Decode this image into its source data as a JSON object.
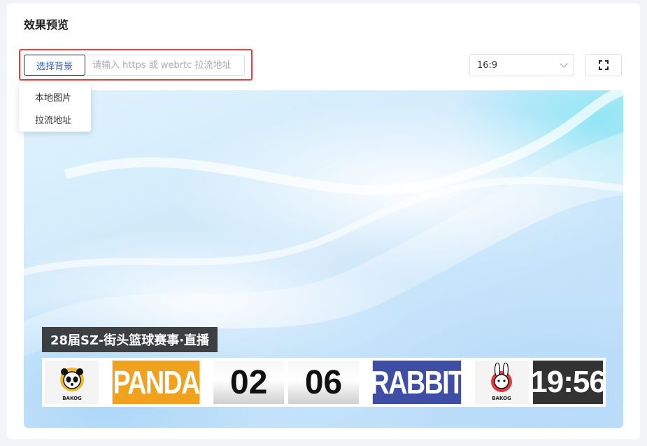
{
  "section": {
    "title": "效果预览"
  },
  "toolbar": {
    "bg_button_label": "选择背景",
    "url_placeholder": "请输入 https 或 webrtc 拉流地址",
    "ratio_value": "16:9"
  },
  "dropdown": {
    "items": [
      {
        "label": "本地图片"
      },
      {
        "label": "拉流地址"
      }
    ]
  },
  "preview": {
    "match_title": "28届SZ-街头篮球赛事·直播",
    "scoreboard": {
      "home_team": "PANDA",
      "home_score": "02",
      "away_score": "06",
      "away_team": "RABBIT",
      "clock": "19:56",
      "home_logo_text": "BAKOG",
      "away_logo_text": "BAKOG"
    }
  },
  "colors": {
    "accent": "#2f5fd8",
    "highlight": "#e8413e",
    "home_team": "#f0a21f",
    "away_team": "#3f4ea5"
  }
}
